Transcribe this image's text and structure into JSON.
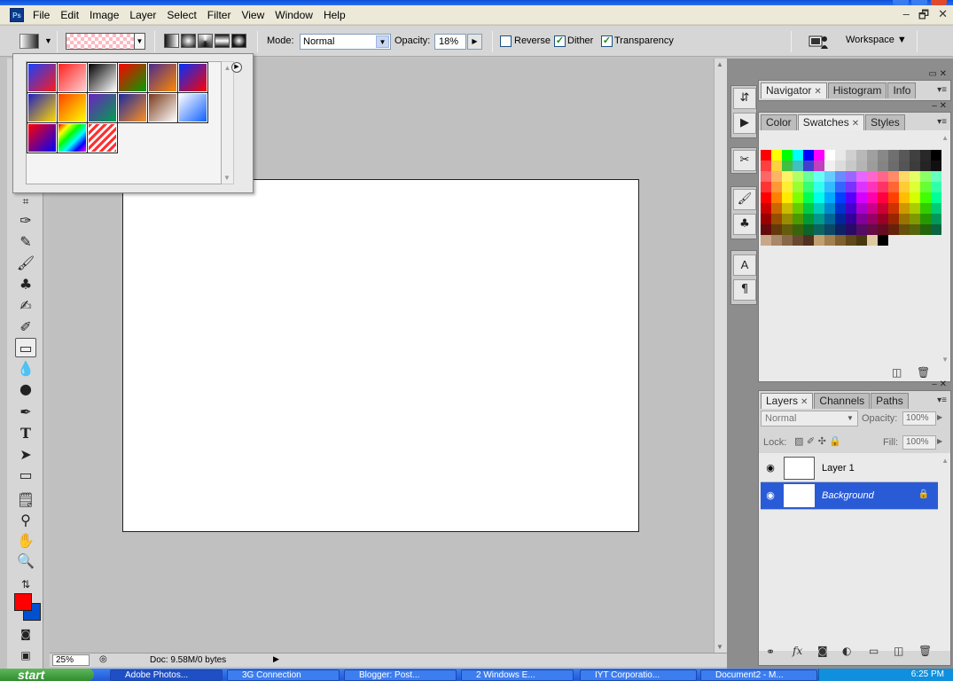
{
  "menu": {
    "app_logo": "Ps",
    "items": [
      "File",
      "Edit",
      "Image",
      "Layer",
      "Select",
      "Filter",
      "View",
      "Window",
      "Help"
    ],
    "window_controls": [
      "–",
      "🗗",
      "✕"
    ]
  },
  "options": {
    "mode_label": "Mode:",
    "mode_value": "Normal",
    "opacity_label": "Opacity:",
    "opacity_value": "18%",
    "reverse_label": "Reverse",
    "dither_label": "Dither",
    "transparency_label": "Transparency",
    "reverse_checked": false,
    "dither_checked": true,
    "transparency_checked": true,
    "workspace_label": "Workspace ▼"
  },
  "gradient_picker": {
    "gradients": [
      [
        "#1840ff",
        "#ff1a1a"
      ],
      [
        "#ff2020",
        "#ffd0d0"
      ],
      [
        "#000000",
        "#ffffff"
      ],
      [
        "#ff0000",
        "#00a000"
      ],
      [
        "#4a2a90",
        "#ff8a00"
      ],
      [
        "#0030ff",
        "#ff0000"
      ],
      [
        "#2020c0",
        "#ffd800"
      ],
      [
        "#ff4000",
        "#ffff00"
      ],
      [
        "#7020c0",
        "#00a050"
      ],
      [
        "#1a2aa0",
        "#ff9020"
      ],
      [
        "#7a3a1a",
        "#ffffff"
      ],
      [
        "#ffffff",
        "#1060ff"
      ],
      [
        "#ff0000",
        "#0000ff"
      ],
      [
        "#ff00ff",
        "#00ff00"
      ],
      [
        "#ff3030",
        "#ffffff"
      ]
    ]
  },
  "panels": {
    "nav_tabs": [
      "Navigator",
      "Histogram",
      "Info"
    ],
    "color_tabs": [
      "Color",
      "Swatches",
      "Styles"
    ],
    "layers_tabs": [
      "Layers",
      "Channels",
      "Paths"
    ],
    "blend_mode": "Normal",
    "opacity_label": "Opacity:",
    "opacity_value": "100%",
    "lock_label": "Lock:",
    "fill_label": "Fill:",
    "fill_value": "100%",
    "layers": [
      {
        "name": "Layer 1",
        "selected": false
      },
      {
        "name": "Background",
        "selected": true
      }
    ]
  },
  "status": {
    "zoom": "25%",
    "doc_info": "Doc: 9.58M/0 bytes"
  },
  "taskbar": {
    "start_label": "start",
    "tasks": [
      "Adobe Photos...",
      "3G Connection",
      "Blogger: Post...",
      "2 Windows E...",
      "IYT Corporatio...",
      "Document2 - M..."
    ],
    "clock": "6:25 PM"
  },
  "colors": {
    "foreground": "#ff0000",
    "background": "#0050d0",
    "accent": "#2a5bd7"
  }
}
